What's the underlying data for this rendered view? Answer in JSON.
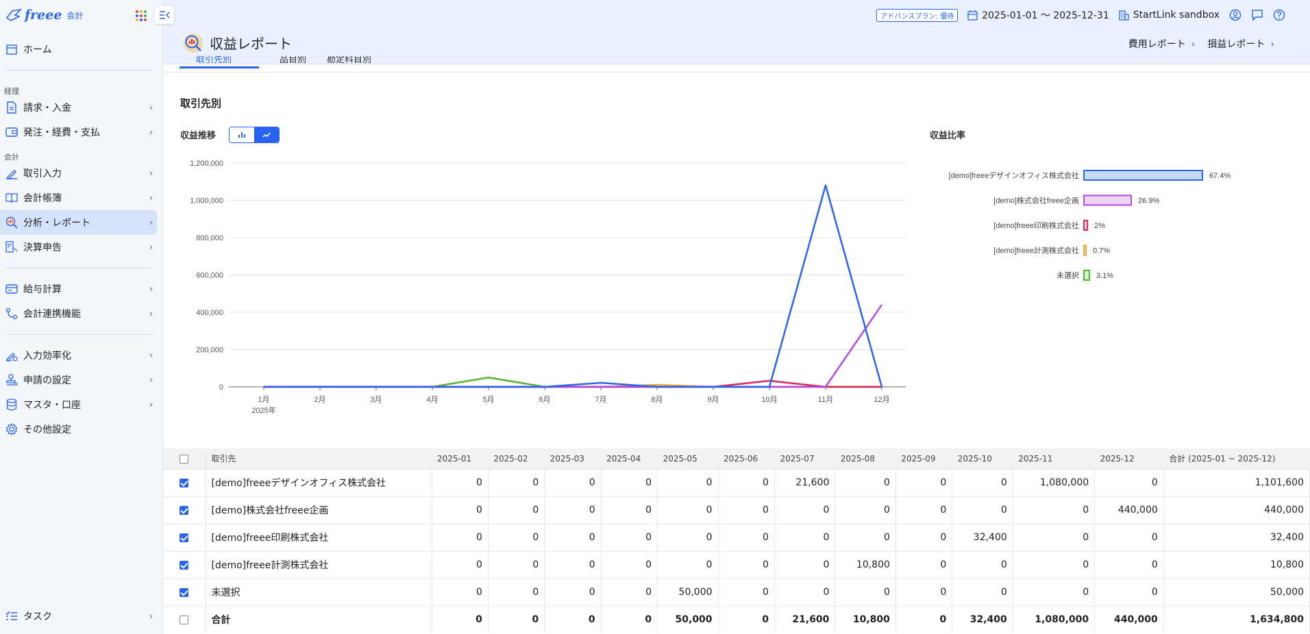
{
  "app": {
    "logo_text": "freee",
    "logo_sub": "会計"
  },
  "sidebar": {
    "home": "ホーム",
    "section_keiri": "経理",
    "section_kaikei": "会計",
    "items_keiri": [
      {
        "label": "請求・入金",
        "name": "sidebar-item-invoice"
      },
      {
        "label": "発注・経費・支払",
        "name": "sidebar-item-expense"
      }
    ],
    "items_kaikei": [
      {
        "label": "取引入力",
        "name": "sidebar-item-transaction"
      },
      {
        "label": "会計帳簿",
        "name": "sidebar-item-ledger"
      },
      {
        "label": "分析・レポート",
        "name": "sidebar-item-report"
      },
      {
        "label": "決算申告",
        "name": "sidebar-item-closing"
      }
    ],
    "items_other": [
      {
        "label": "給与計算",
        "name": "sidebar-item-payroll"
      },
      {
        "label": "会計連携機能",
        "name": "sidebar-item-integration"
      }
    ],
    "items_settings": [
      {
        "label": "入力効率化",
        "name": "sidebar-item-efficiency"
      },
      {
        "label": "申請の設定",
        "name": "sidebar-item-approval"
      },
      {
        "label": "マスタ・口座",
        "name": "sidebar-item-master"
      },
      {
        "label": "その他設定",
        "name": "sidebar-item-other-settings"
      }
    ],
    "task": "タスク"
  },
  "topbar": {
    "plan": "アドバンスプラン: 優待",
    "period": "2025-01-01 〜 2025-12-31",
    "company": "StartLink sandbox"
  },
  "header": {
    "title": "収益レポート",
    "link_expense": "費用レポート",
    "link_pl": "損益レポート"
  },
  "tabs": [
    "取引先別",
    "品目別",
    "勘定科目別"
  ],
  "content": {
    "section_title": "取引先別",
    "trend_label": "収益推移",
    "ratio_label": "収益比率"
  },
  "chart_data": {
    "type": "line",
    "x": [
      "1月",
      "2月",
      "3月",
      "4月",
      "5月",
      "6月",
      "7月",
      "8月",
      "9月",
      "10月",
      "11月",
      "12月"
    ],
    "x_sublabel": "2025年",
    "ylim": [
      0,
      1200000
    ],
    "yticks": [
      "0",
      "200,000",
      "400,000",
      "600,000",
      "800,000",
      "1,000,000",
      "1,200,000"
    ],
    "series": [
      {
        "name": "[demo]freeeデザインオフィス株式会社",
        "color": "#2864f0",
        "values": [
          0,
          0,
          0,
          0,
          0,
          0,
          21600,
          0,
          0,
          0,
          1080000,
          0
        ]
      },
      {
        "name": "[demo]株式会社freee企画",
        "color": "#b547e6",
        "values": [
          0,
          0,
          0,
          0,
          0,
          0,
          0,
          0,
          0,
          0,
          0,
          440000
        ]
      },
      {
        "name": "[demo]freee印刷株式会社",
        "color": "#d6285f",
        "values": [
          0,
          0,
          0,
          0,
          0,
          0,
          0,
          0,
          0,
          32400,
          0,
          0
        ]
      },
      {
        "name": "[demo]freee計測株式会社",
        "color": "#e8a93a",
        "values": [
          0,
          0,
          0,
          0,
          0,
          0,
          0,
          10800,
          0,
          0,
          0,
          0
        ]
      },
      {
        "name": "未選択",
        "color": "#4db82f",
        "values": [
          0,
          0,
          0,
          0,
          50000,
          0,
          0,
          0,
          0,
          0,
          0,
          0
        ]
      }
    ],
    "grid": true
  },
  "ratio_data": {
    "type": "bar",
    "items": [
      {
        "name": "[demo]freeeデザインオフィス株式会社",
        "pct": 67.4,
        "label": "67.4%",
        "color": "#2864f0",
        "fill": "#c8daf9"
      },
      {
        "name": "[demo]株式会社freee企画",
        "pct": 26.9,
        "label": "26.9%",
        "color": "#b547e6",
        "fill": "#ecd4f7"
      },
      {
        "name": "[demo]freee印刷株式会社",
        "pct": 2,
        "label": "2%",
        "color": "#d6285f",
        "fill": "#f6cfd9"
      },
      {
        "name": "[demo]freee計測株式会社",
        "pct": 0.7,
        "label": "0.7%",
        "color": "#e8a93a",
        "fill": "#f9e7c4"
      },
      {
        "name": "未選択",
        "pct": 3.1,
        "label": "3.1%",
        "color": "#4db82f",
        "fill": "#d6f0cc"
      }
    ]
  },
  "table": {
    "headers": [
      "取引先",
      "2025-01",
      "2025-02",
      "2025-03",
      "2025-04",
      "2025-05",
      "2025-06",
      "2025-07",
      "2025-08",
      "2025-09",
      "2025-10",
      "2025-11",
      "2025-12",
      "合計 (2025-01 ~ 2025-12)"
    ],
    "rows": [
      {
        "name": "[demo]freeeデザインオフィス株式会社",
        "checked": true,
        "cells": [
          "0",
          "0",
          "0",
          "0",
          "0",
          "0",
          "21,600",
          "0",
          "0",
          "0",
          "1,080,000",
          "0",
          "1,101,600"
        ]
      },
      {
        "name": "[demo]株式会社freee企画",
        "checked": true,
        "cells": [
          "0",
          "0",
          "0",
          "0",
          "0",
          "0",
          "0",
          "0",
          "0",
          "0",
          "0",
          "440,000",
          "440,000"
        ]
      },
      {
        "name": "[demo]freee印刷株式会社",
        "checked": true,
        "cells": [
          "0",
          "0",
          "0",
          "0",
          "0",
          "0",
          "0",
          "0",
          "0",
          "32,400",
          "0",
          "0",
          "32,400"
        ]
      },
      {
        "name": "[demo]freee計測株式会社",
        "checked": true,
        "cells": [
          "0",
          "0",
          "0",
          "0",
          "0",
          "0",
          "0",
          "10,800",
          "0",
          "0",
          "0",
          "0",
          "10,800"
        ]
      },
      {
        "name": "未選択",
        "checked": true,
        "cells": [
          "0",
          "0",
          "0",
          "0",
          "50,000",
          "0",
          "0",
          "0",
          "0",
          "0",
          "0",
          "0",
          "50,000"
        ]
      }
    ],
    "total": {
      "name": "合計",
      "checked": false,
      "cells": [
        "0",
        "0",
        "0",
        "0",
        "50,000",
        "0",
        "21,600",
        "10,800",
        "0",
        "32,400",
        "1,080,000",
        "440,000",
        "1,634,800"
      ]
    }
  }
}
